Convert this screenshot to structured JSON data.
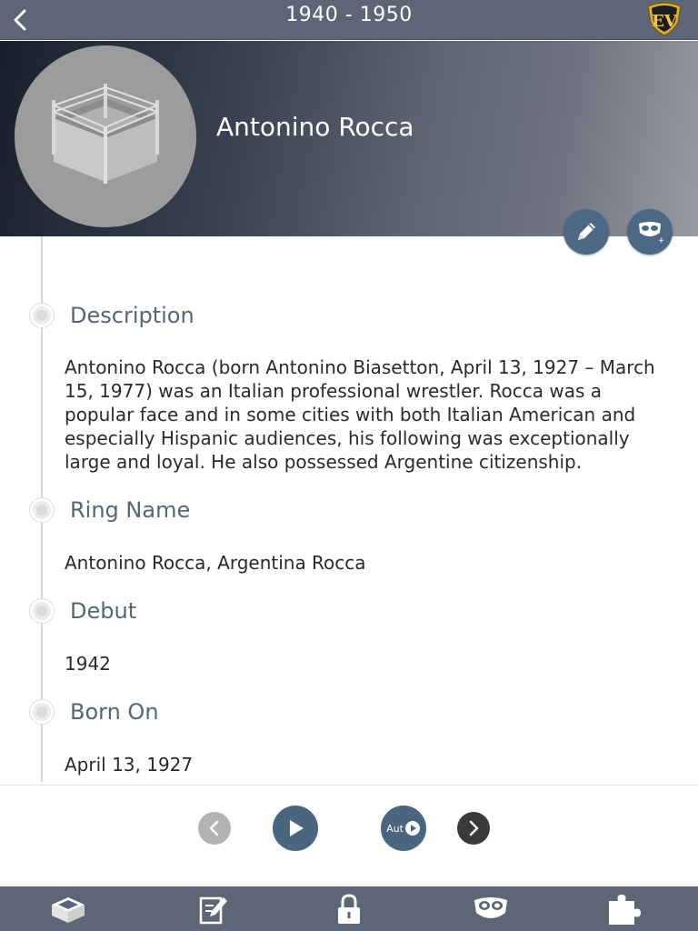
{
  "nav": {
    "title": "1940 - 1950",
    "logo_text": "EV"
  },
  "profile": {
    "name": "Antonino Rocca"
  },
  "fields": [
    {
      "label": "Description",
      "value": "Antonino Rocca (born Antonino Biasetton, April 13, 1927 – March 15, 1977) was an Italian professional wrestler. Rocca was a popular face and in some cities with both Italian American and especially Hispanic audiences, his following was exceptionally large and loyal. He also possessed Argentine citizenship."
    },
    {
      "label": "Ring Name",
      "value": "Antonino Rocca, Argentina Rocca"
    },
    {
      "label": "Debut",
      "value": "1942"
    },
    {
      "label": "Born On",
      "value": "April 13, 1927"
    }
  ],
  "controls": {
    "auto_label": "Aut"
  },
  "icons": {
    "back": "chevron-left-icon",
    "logo": "ev-logo-icon",
    "avatar": "wrestling-ring-icon",
    "edit": "pencil-icon",
    "favorite": "mask-add-icon",
    "prev": "chevron-left-icon",
    "play": "play-icon",
    "auto": "autoplay-icon",
    "next": "chevron-right-icon",
    "tab_ring": "wrestling-ring-icon",
    "tab_notes": "note-edit-icon",
    "tab_lock": "lock-icon",
    "tab_mask": "mask-icon",
    "tab_puzzle": "puzzle-icon"
  },
  "colors": {
    "nav_bar": "#5d6676",
    "accent_button": "#4a6580",
    "label_text": "#5a6472",
    "logo_gold": "#d9b13a"
  }
}
